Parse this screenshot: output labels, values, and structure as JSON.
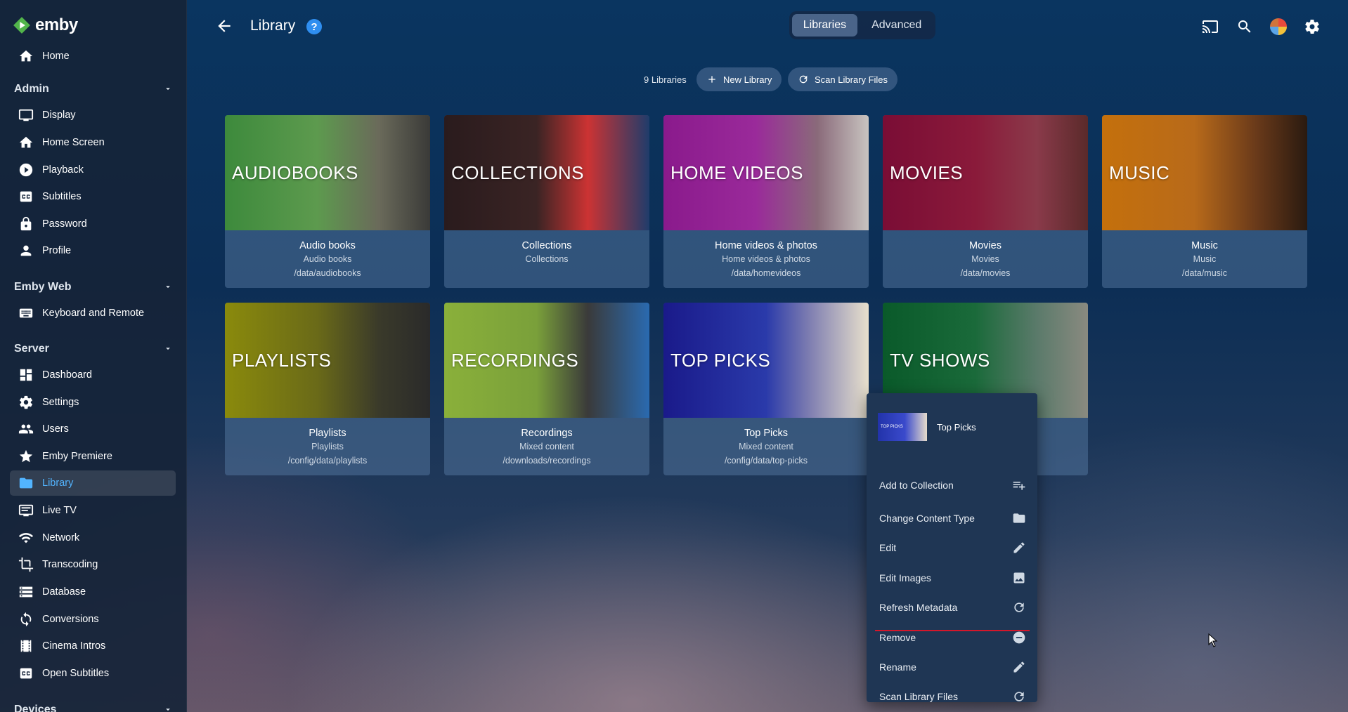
{
  "app": {
    "logo_text": "emby"
  },
  "sidebar": {
    "home": "Home",
    "sections": [
      {
        "title": "Admin",
        "items": [
          "Display",
          "Home Screen",
          "Playback",
          "Subtitles",
          "Password",
          "Profile"
        ]
      },
      {
        "title": "Emby Web",
        "items": [
          "Keyboard and Remote"
        ]
      },
      {
        "title": "Server",
        "items": [
          "Dashboard",
          "Settings",
          "Users",
          "Emby Premiere",
          "Library",
          "Live TV",
          "Network",
          "Transcoding",
          "Database",
          "Conversions",
          "Cinema Intros",
          "Open Subtitles"
        ]
      },
      {
        "title": "Devices"
      }
    ],
    "active_item": "Library"
  },
  "header": {
    "title": "Library",
    "tabs": [
      "Libraries",
      "Advanced"
    ],
    "active_tab": "Libraries"
  },
  "toolbar": {
    "count": "9 Libraries",
    "new_library": "New Library",
    "scan": "Scan Library Files"
  },
  "libraries": [
    {
      "art_label": "AUDIOBOOKS",
      "name": "Audio books",
      "type": "Audio books",
      "path": "/data/audiobooks"
    },
    {
      "art_label": "COLLECTIONS",
      "name": "Collections",
      "type": "Collections",
      "path": ""
    },
    {
      "art_label": "HOME VIDEOS",
      "name": "Home videos & photos",
      "type": "Home videos & photos",
      "path": "/data/homevideos"
    },
    {
      "art_label": "MOVIES",
      "name": "Movies",
      "type": "Movies",
      "path": "/data/movies"
    },
    {
      "art_label": "MUSIC",
      "name": "Music",
      "type": "Music",
      "path": "/data/music"
    },
    {
      "art_label": "PLAYLISTS",
      "name": "Playlists",
      "type": "Playlists",
      "path": "/config/data/playlists"
    },
    {
      "art_label": "RECORDINGS",
      "name": "Recordings",
      "type": "Mixed content",
      "path": "/downloads/recordings"
    },
    {
      "art_label": "TOP PICKS",
      "name": "Top Picks",
      "type": "Mixed content",
      "path": "/config/data/top-picks"
    },
    {
      "art_label": "TV SHOWS",
      "name": "",
      "type": "",
      "path": ""
    }
  ],
  "context_menu": {
    "title": "Top Picks",
    "thumb_label": "TOP PICKS",
    "items": [
      "Add to Collection",
      "Change Content Type",
      "Edit",
      "Edit Images",
      "Refresh Metadata",
      "Remove",
      "Rename",
      "Scan Library Files"
    ]
  },
  "colors": {
    "accent": "#52b4ff",
    "brand_green": "#52b54b",
    "remove_underline": "#d5172b"
  }
}
